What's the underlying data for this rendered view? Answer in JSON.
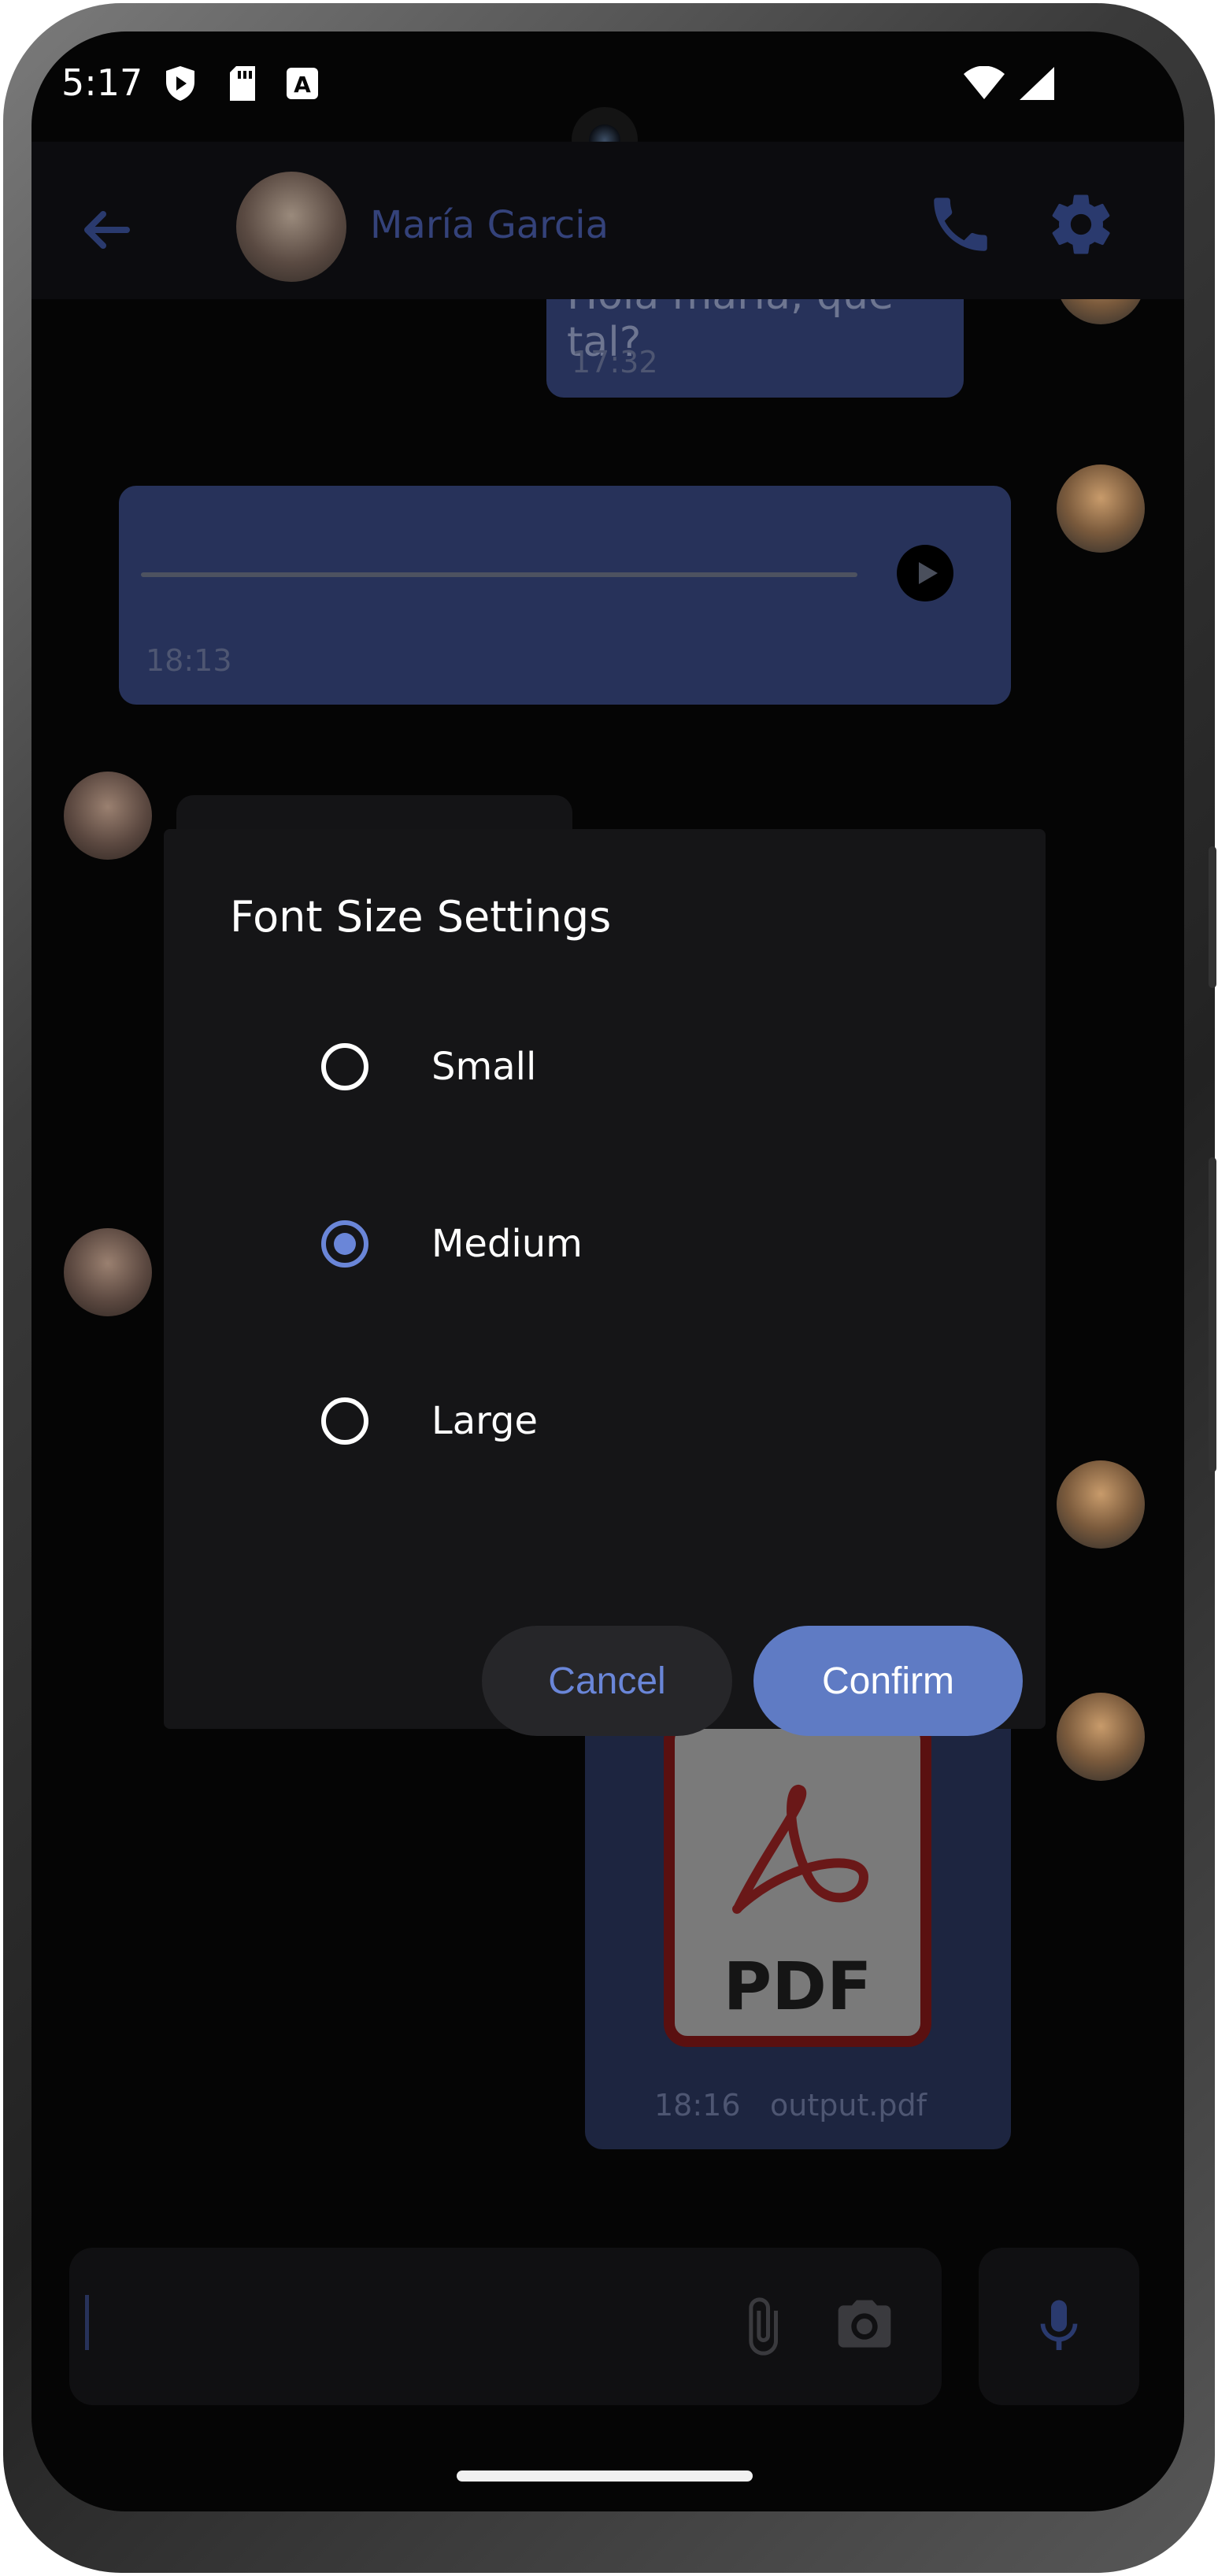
{
  "status_bar": {
    "time": "5:17"
  },
  "header": {
    "contact_name": "María Garcia"
  },
  "messages": [
    {
      "type": "text",
      "text": "Hola maría, que tal?",
      "time": "17:32"
    },
    {
      "type": "voice",
      "time": "18:13"
    },
    {
      "type": "pdf",
      "icon_text": "PDF",
      "time": "18:16",
      "filename": "output.pdf"
    }
  ],
  "dialog": {
    "title": "Font Size Settings",
    "options": [
      {
        "label": "Small",
        "selected": false
      },
      {
        "label": "Medium",
        "selected": true
      },
      {
        "label": "Large",
        "selected": false
      }
    ],
    "cancel_label": "Cancel",
    "confirm_label": "Confirm"
  },
  "colors": {
    "accent": "#6a86d8",
    "dialog_bg": "#151517",
    "scrim": "#000000"
  },
  "icons": [
    "back-arrow-icon",
    "phone-icon",
    "gear-icon",
    "play-icon",
    "paperclip-icon",
    "camera-icon",
    "microphone-icon"
  ]
}
